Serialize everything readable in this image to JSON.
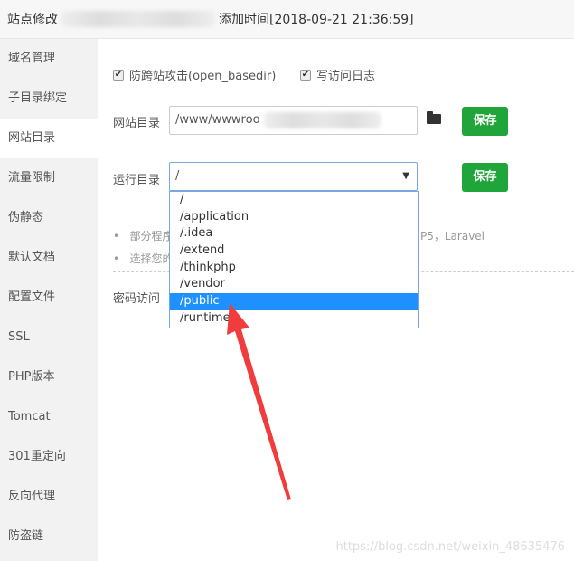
{
  "header": {
    "title": "站点修改",
    "added_time": "添加时间[2018-09-21 21:36:59]"
  },
  "sidebar": {
    "items": [
      {
        "label": "域名管理"
      },
      {
        "label": "子目录绑定"
      },
      {
        "label": "网站目录",
        "active": true
      },
      {
        "label": "流量限制"
      },
      {
        "label": "伪静态"
      },
      {
        "label": "默认文档"
      },
      {
        "label": "配置文件"
      },
      {
        "label": "SSL"
      },
      {
        "label": "PHP版本"
      },
      {
        "label": "Tomcat"
      },
      {
        "label": "301重定向"
      },
      {
        "label": "反向代理"
      },
      {
        "label": "防盗链"
      }
    ]
  },
  "main": {
    "checkbox_basedir": {
      "label": "防跨站攻击(open_basedir)",
      "checked": true
    },
    "checkbox_log": {
      "label": "写访问日志",
      "checked": true
    },
    "site_dir": {
      "label": "网站目录",
      "value": "/www/wwwroo",
      "save": "保存"
    },
    "run_dir": {
      "label": "运行目录",
      "value": "/",
      "save": "保存",
      "options": [
        "/",
        "/application",
        "/.idea",
        "/extend",
        "/thinkphp",
        "/vendor",
        "/public",
        "/runtime"
      ],
      "highlighted": "/public"
    },
    "tips": [
      "部分程序",
      "P5，Laravel",
      "选择您的"
    ],
    "password_access": "密码访问"
  },
  "watermark": "https://blog.csdn.net/weixin_48635476",
  "colors": {
    "accent": "#20a53a",
    "highlight": "#1e90ff",
    "arrow": "#f03c3c"
  }
}
